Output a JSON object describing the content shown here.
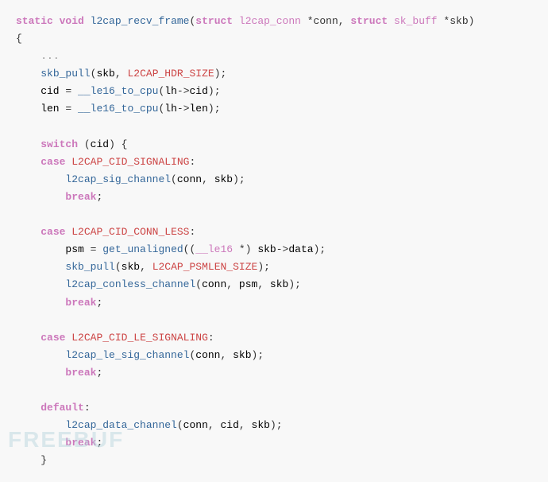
{
  "watermark": "FREEBUF",
  "code": {
    "signature": "static void l2cap_recv_frame(struct l2cap_conn *conn, struct sk_buff *skb)",
    "lines": []
  }
}
